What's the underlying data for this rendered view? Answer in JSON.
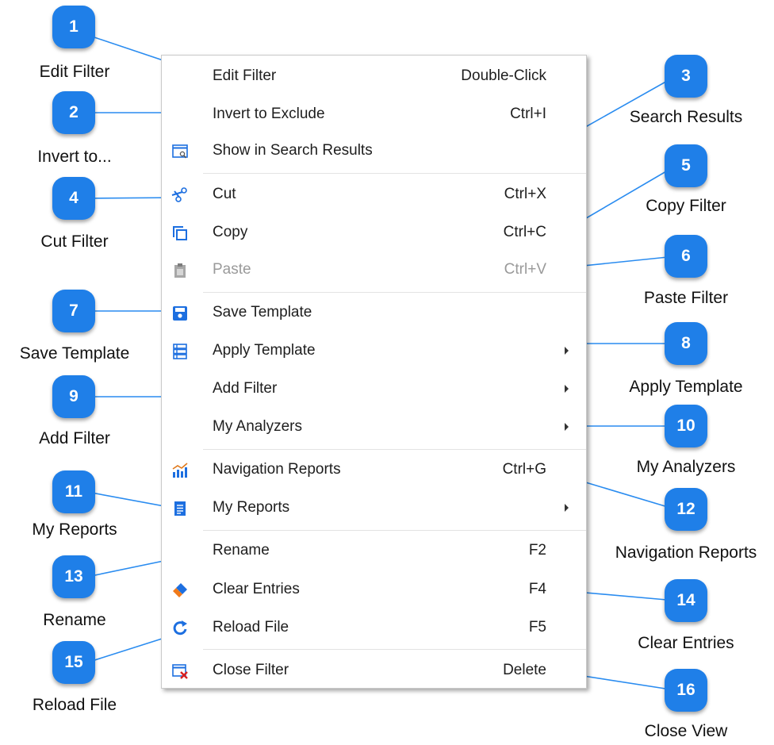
{
  "colors": {
    "accent": "#1f7fe8",
    "leader": "#2a8cf0",
    "icon_blue": "#1d6fe0",
    "icon_red": "#d92020"
  },
  "menu": {
    "items": [
      {
        "label": "Edit Filter",
        "shortcut": "Double-Click",
        "icon": ""
      },
      {
        "label": "Invert to Exclude",
        "shortcut": "Ctrl+I",
        "icon": ""
      },
      {
        "label": "Show in Search Results",
        "shortcut": "",
        "icon": "search-results-window-icon"
      },
      {
        "label": "Cut",
        "shortcut": "Ctrl+X",
        "icon": "scissors-icon"
      },
      {
        "label": "Copy",
        "shortcut": "Ctrl+C",
        "icon": "copy-icon"
      },
      {
        "label": "Paste",
        "shortcut": "Ctrl+V",
        "icon": "clipboard-icon",
        "disabled": true
      },
      {
        "label": "Save Template",
        "shortcut": "",
        "icon": "save-icon"
      },
      {
        "label": "Apply Template",
        "shortcut": "",
        "icon": "template-stack-icon",
        "submenu": true
      },
      {
        "label": "Add Filter",
        "shortcut": "",
        "icon": "",
        "submenu": true
      },
      {
        "label": "My Analyzers",
        "shortcut": "",
        "icon": "",
        "submenu": true
      },
      {
        "label": "Navigation Reports",
        "shortcut": "Ctrl+G",
        "icon": "bar-chart-icon"
      },
      {
        "label": "My Reports",
        "shortcut": "",
        "icon": "report-list-icon",
        "submenu": true
      },
      {
        "label": "Rename",
        "shortcut": "F2",
        "icon": ""
      },
      {
        "label": "Clear Entries",
        "shortcut": "F4",
        "icon": "eraser-icon"
      },
      {
        "label": "Reload File",
        "shortcut": "F5",
        "icon": "reload-icon"
      },
      {
        "label": "Close Filter",
        "shortcut": "Delete",
        "icon": "close-window-icon"
      }
    ]
  },
  "callouts": [
    {
      "number": "1",
      "caption": "Edit Filter"
    },
    {
      "number": "2",
      "caption": "Invert to..."
    },
    {
      "number": "3",
      "caption": "Search Results"
    },
    {
      "number": "4",
      "caption": "Cut Filter"
    },
    {
      "number": "5",
      "caption": "Copy Filter"
    },
    {
      "number": "6",
      "caption": "Paste Filter"
    },
    {
      "number": "7",
      "caption": "Save Template"
    },
    {
      "number": "8",
      "caption": "Apply Template"
    },
    {
      "number": "9",
      "caption": "Add Filter"
    },
    {
      "number": "10",
      "caption": "My Analyzers"
    },
    {
      "number": "11",
      "caption": "My Reports"
    },
    {
      "number": "12",
      "caption": "Navigation Reports"
    },
    {
      "number": "13",
      "caption": "Rename"
    },
    {
      "number": "14",
      "caption": "Clear Entries"
    },
    {
      "number": "15",
      "caption": "Reload File"
    },
    {
      "number": "16",
      "caption": "Close View"
    }
  ]
}
